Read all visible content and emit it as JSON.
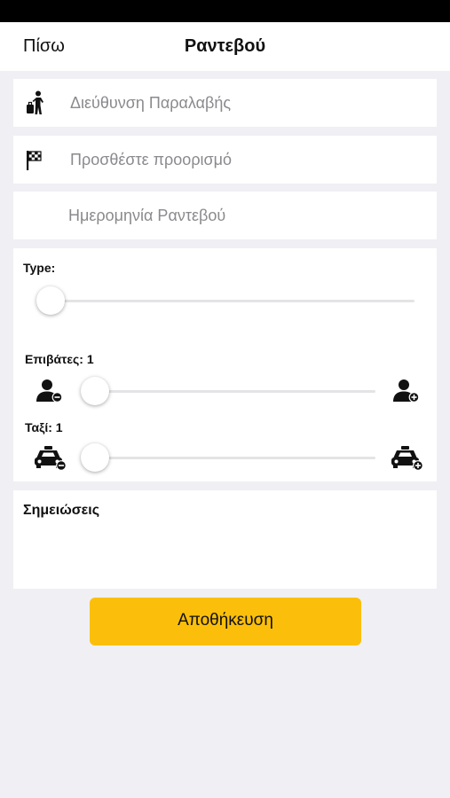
{
  "nav": {
    "back_label": "Πίσω",
    "title": "Ραντεβού"
  },
  "fields": {
    "pickup": {
      "placeholder": "Διεύθυνση Παραλαβής",
      "icon": "pedestrian-luggage-icon"
    },
    "destination": {
      "placeholder": "Προσθέστε προορισμό",
      "icon": "checkered-flag-icon"
    },
    "date": {
      "placeholder": "Ημερομηνία Ραντεβού"
    }
  },
  "options": {
    "type_label": "Type:",
    "passengers_label": "Επιβάτες: 1",
    "passengers_value": 1,
    "taxis_label": "Ταξί: 1",
    "taxis_value": 1,
    "icons": [
      "person-minus-icon",
      "person-plus-icon",
      "taxi-minus-icon",
      "taxi-plus-icon"
    ]
  },
  "notes": {
    "label": "Σημειώσεις"
  },
  "save": {
    "label": "Αποθήκευση"
  },
  "colors": {
    "accent": "#fbbf0b",
    "background": "#efeff4",
    "status_bar": "#000000"
  }
}
